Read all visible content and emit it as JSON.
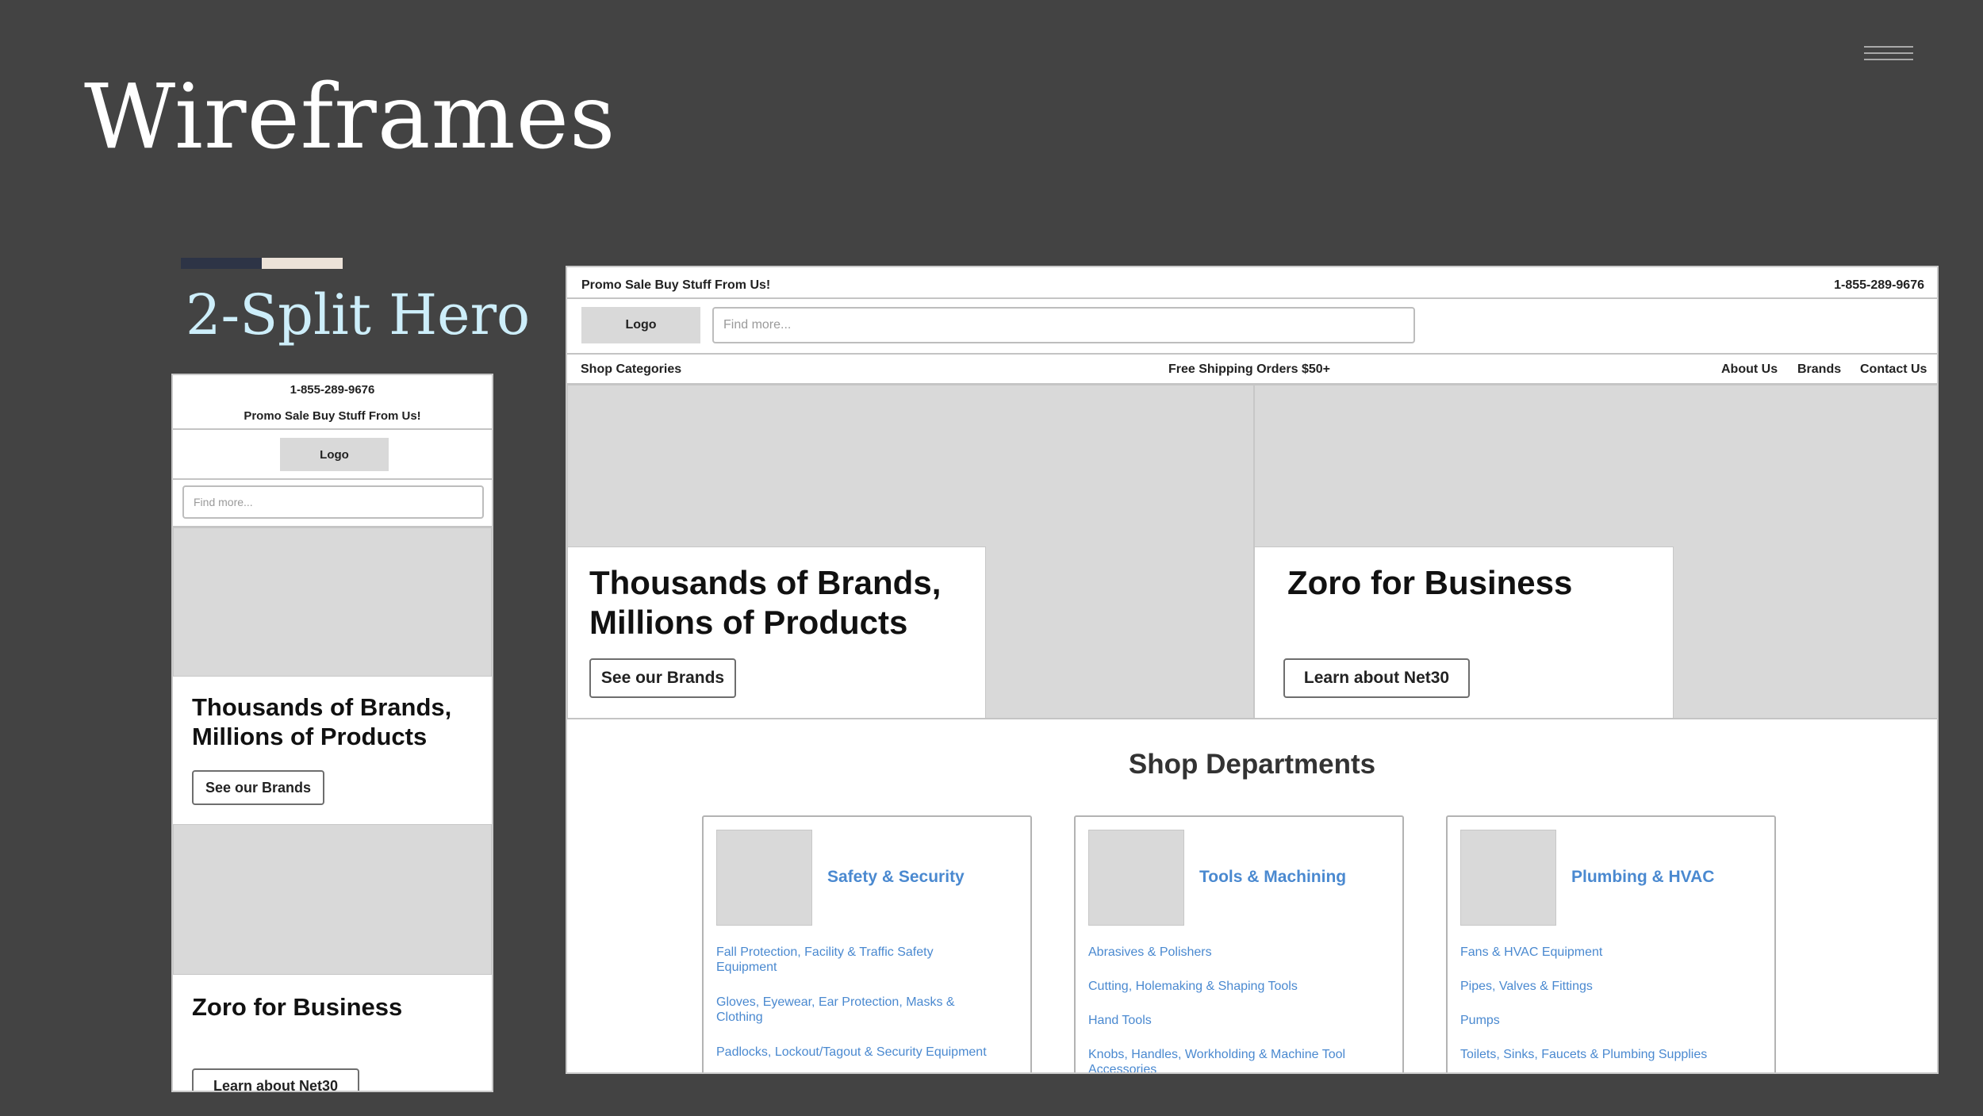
{
  "slide": {
    "title": "Wireframes",
    "subtitle": "2-Split Hero",
    "colors": {
      "background": "#434343",
      "accent_dark": "#2d3446",
      "accent_light": "#ece2d8",
      "subtitle": "#cdeefa",
      "link": "#4a89d0"
    }
  },
  "menu_icon": "hamburger-menu-icon",
  "mobile": {
    "phone": "1-855-289-9676",
    "promo": "Promo Sale Buy Stuff From Us!",
    "logo": "Logo",
    "search_placeholder": "Find more...",
    "hero1": {
      "heading": "Thousands of Brands, Millions of Products",
      "button": "See our Brands"
    },
    "hero2": {
      "heading": "Zoro for Business",
      "button": "Learn about Net30"
    }
  },
  "desktop": {
    "promo": "Promo Sale Buy Stuff From Us!",
    "phone": "1-855-289-9676",
    "logo": "Logo",
    "search_placeholder": "Find more...",
    "nav": {
      "categories": "Shop Categories",
      "shipping": "Free Shipping Orders $50+",
      "about": "About Us",
      "brands": "Brands",
      "contact": "Contact Us"
    },
    "hero1": {
      "heading_line1": "Thousands of Brands,",
      "heading_line2": "Millions of Products",
      "button": "See our Brands"
    },
    "hero2": {
      "heading": "Zoro for Business",
      "button": "Learn about Net30"
    },
    "departments": {
      "title": "Shop Departments",
      "cards": [
        {
          "title": "Safety & Security",
          "links": [
            "Fall Protection, Facility & Traffic Safety Equipment",
            "Gloves, Eyewear, Ear Protection, Masks & Clothing",
            "Padlocks, Lockout/Tagout & Security Equipment"
          ]
        },
        {
          "title": "Tools & Machining",
          "links": [
            "Abrasives & Polishers",
            "Cutting, Holemaking & Shaping Tools",
            "Hand Tools",
            "Knobs, Handles, Workholding & Machine Tool Accessories"
          ]
        },
        {
          "title": "Plumbing & HVAC",
          "links": [
            "Fans & HVAC Equipment",
            "Pipes, Valves & Fittings",
            "Pumps",
            "Toilets, Sinks, Faucets & Plumbing Supplies"
          ]
        }
      ]
    }
  }
}
